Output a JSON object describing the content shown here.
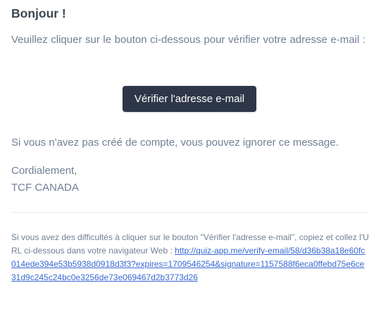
{
  "email": {
    "greeting": "Bonjour !",
    "intro": "Veuillez cliquer sur le bouton ci-dessous pour vérifier votre adresse e-mail :",
    "button_label": "Vérifier l'adresse e-mail",
    "ignore_text": "Si vous n'avez pas créé de compte, vous pouvez ignorer ce message.",
    "salutation": "Cordialement,",
    "signature": "TCF CANADA",
    "subcopy_text": "Si vous avez des difficultés à cliquer sur le bouton \"Vérifier l'adresse e-mail\", copiez et collez l'URL ci-dessous dans votre navigateur Web : ",
    "verify_url": "http://quiz-app.me/verify-email/58/d36b38a18e60fc014ede394e53b5938d0918d3f3?expires=1709546254&signature=1157588f6eca0ffebd75e6ce31d9c245c24bc0e3256de73e069467d2b3773d26"
  },
  "colors": {
    "heading": "#3d4852",
    "body_text": "#718096",
    "button_bg": "#2d3748",
    "button_text": "#ffffff",
    "link": "#3869d4",
    "divider": "#e8e5ef"
  }
}
